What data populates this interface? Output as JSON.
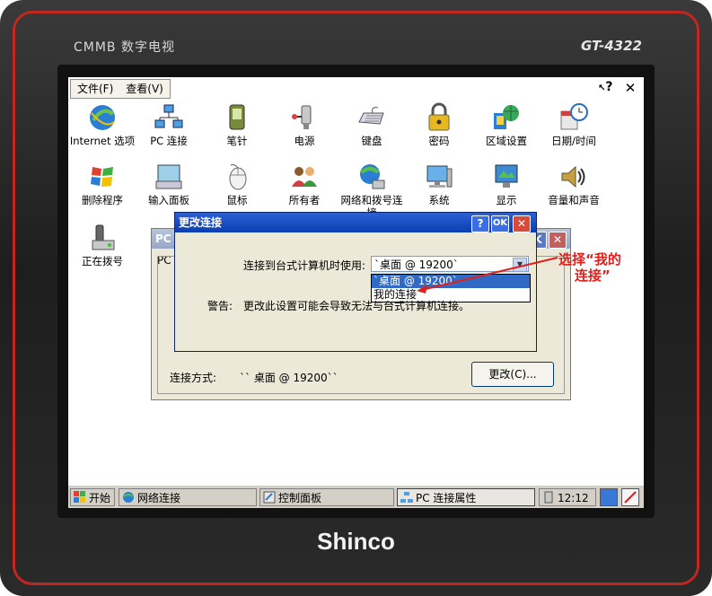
{
  "device": {
    "brand_top": "CMMB 数字电视",
    "model": "GT-4322",
    "brand_bottom": "Shinco"
  },
  "menubar": {
    "file": "文件(F)",
    "view": "查看(V)",
    "help_glyph": "?",
    "close_glyph": "✕"
  },
  "icons": [
    {
      "label": "Internet 选项",
      "icon": "internet-options-icon"
    },
    {
      "label": "PC 连接",
      "icon": "pc-connection-icon"
    },
    {
      "label": "笔针",
      "icon": "stylus-icon"
    },
    {
      "label": "电源",
      "icon": "power-icon"
    },
    {
      "label": "键盘",
      "icon": "keyboard-icon"
    },
    {
      "label": "密码",
      "icon": "password-icon"
    },
    {
      "label": "区域设置",
      "icon": "regional-settings-icon"
    },
    {
      "label": "日期/时间",
      "icon": "date-time-icon"
    },
    {
      "label": "删除程序",
      "icon": "remove-programs-icon"
    },
    {
      "label": "输入面板",
      "icon": "input-panel-icon"
    },
    {
      "label": "鼠标",
      "icon": "mouse-icon"
    },
    {
      "label": "所有者",
      "icon": "owner-icon"
    },
    {
      "label": "网络和拨号连接",
      "icon": "network-dialup-icon"
    },
    {
      "label": "系统",
      "icon": "system-icon"
    },
    {
      "label": "显示",
      "icon": "display-icon"
    },
    {
      "label": "音量和声音",
      "icon": "volume-sound-icon"
    },
    {
      "label": "正在拨号",
      "icon": "dialing-icon"
    }
  ],
  "back_window": {
    "title": "PC",
    "tab": "PC",
    "connect_label": "连接方式:",
    "connect_value": "`` 桌面 @ 19200``",
    "change_button": "更改(C)..."
  },
  "dialog": {
    "title": "更改连接",
    "help": "?",
    "ok": "OK",
    "close": "✕",
    "connect_label": "连接到台式计算机时使用:",
    "combo_value": "`桌面 @ 19200`",
    "options": [
      "`桌面 @ 19200`",
      "我的连接"
    ],
    "warning_label": "警告:",
    "warning_text": "更改此设置可能会导致无法与台式计算机连接。"
  },
  "annotation": {
    "line1": "选择“我的",
    "line2": "连接”",
    "color": "#e0201c"
  },
  "taskbar": {
    "start": "开始",
    "task1": "网络连接",
    "task2": "控制面板",
    "task3": "PC 连接属性",
    "clock": "12:12"
  }
}
